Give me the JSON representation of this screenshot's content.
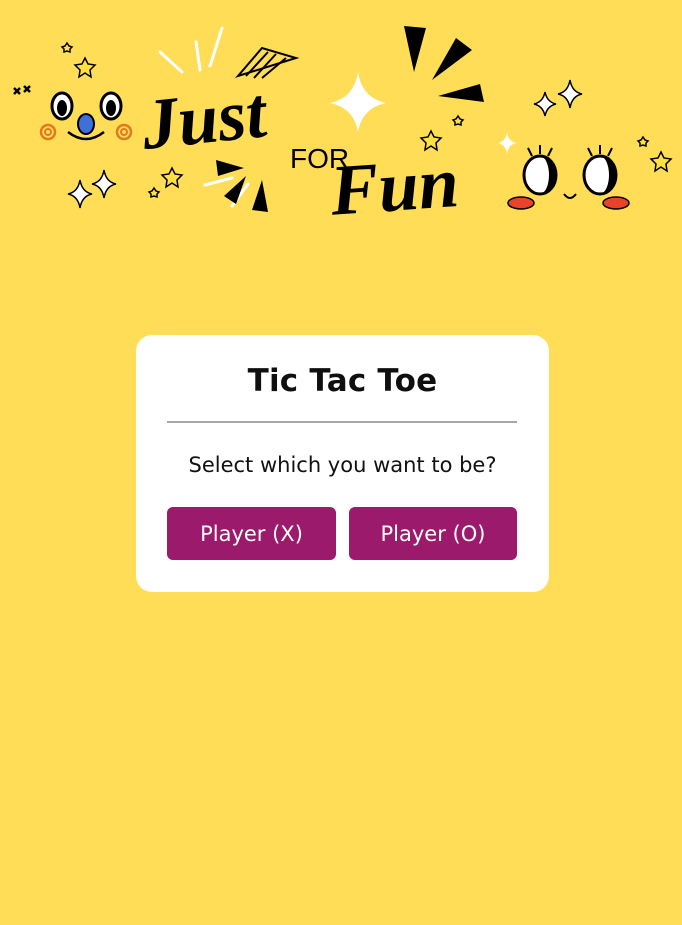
{
  "banner": {
    "word_just": "Just",
    "word_for": "FOR",
    "word_fun": "Fun"
  },
  "card": {
    "title": "Tic Tac Toe",
    "prompt": "Select which you want to be?",
    "buttons": {
      "player_x": "Player (X)",
      "player_o": "Player (O)"
    }
  },
  "colors": {
    "background": "#ffdd57",
    "card": "#ffffff",
    "button": "#9c1a6b",
    "divider": "#a7a7a7"
  }
}
